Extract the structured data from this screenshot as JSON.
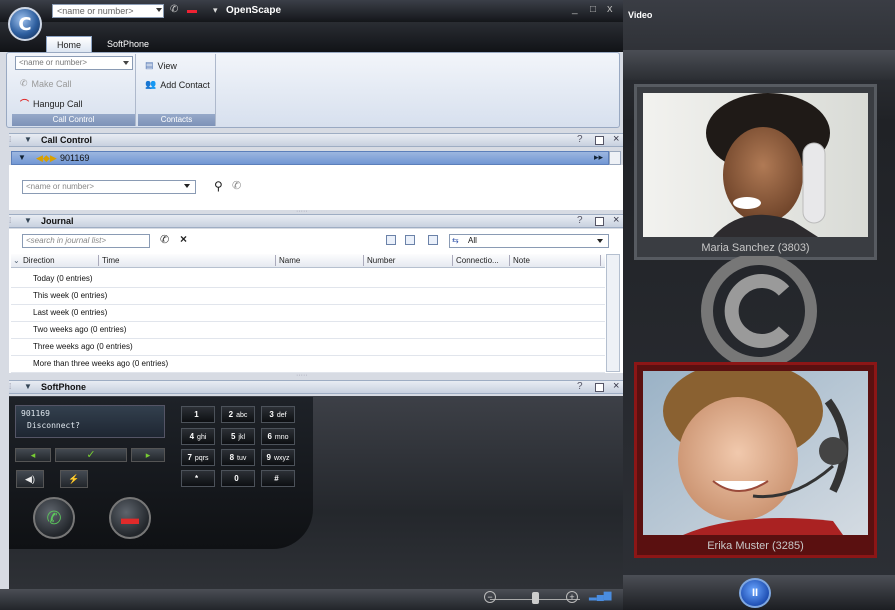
{
  "title_bar": {
    "app_title": "OpenScape",
    "quick_combo_placeholder": "<name or number>",
    "window_controls": {
      "minimize": "_",
      "maximize": "□",
      "close": "x"
    }
  },
  "tabs": [
    {
      "label": "Home"
    },
    {
      "label": "SoftPhone"
    }
  ],
  "ribbon": {
    "combo_placeholder": "<name or number>",
    "make_call": "Make Call",
    "hangup_call": "Hangup Call",
    "group_call_control": "Call Control",
    "view": "View",
    "add_contact": "Add Contact",
    "group_contacts": "Contacts"
  },
  "call_control": {
    "title": "Call Control",
    "active_number": "901169",
    "input_placeholder": "<name or number>"
  },
  "journal": {
    "title": "Journal",
    "search_placeholder": "<search in journal list>",
    "filter_value": "All",
    "columns": [
      "Direction",
      "Time",
      "Name",
      "Number",
      "Connectio...",
      "Note"
    ],
    "rows": [
      "Today (0 entries)",
      "This week (0 entries)",
      "Last week (0 entries)",
      "Two weeks ago (0 entries)",
      "Three weeks ago (0 entries)",
      "More than three weeks ago (0 entries)"
    ]
  },
  "softphone": {
    "title": "SoftPhone",
    "display_number": "901169",
    "display_status": "Disconnect?",
    "keys": [
      {
        "d": "1",
        "l": ""
      },
      {
        "d": "2",
        "l": "abc"
      },
      {
        "d": "3",
        "l": "def"
      },
      {
        "d": "4",
        "l": "ghi"
      },
      {
        "d": "5",
        "l": "jkl"
      },
      {
        "d": "6",
        "l": "mno"
      },
      {
        "d": "7",
        "l": "pqrs"
      },
      {
        "d": "8",
        "l": "tuv"
      },
      {
        "d": "9",
        "l": "wxyz"
      },
      {
        "d": "*",
        "l": ""
      },
      {
        "d": "0",
        "l": ""
      },
      {
        "d": "#",
        "l": ""
      }
    ]
  },
  "video": {
    "title": "Video",
    "participants": [
      {
        "name": "Maria Sanchez (3803)"
      },
      {
        "name": "Erika Muster (3285)"
      }
    ]
  },
  "colors": {
    "accent_blue": "#7297d4",
    "ribbon_label": "#7d92b8",
    "hangup_red": "#e02a2a",
    "call_green": "#4caf50",
    "active_frame_red": "#8c1616"
  }
}
